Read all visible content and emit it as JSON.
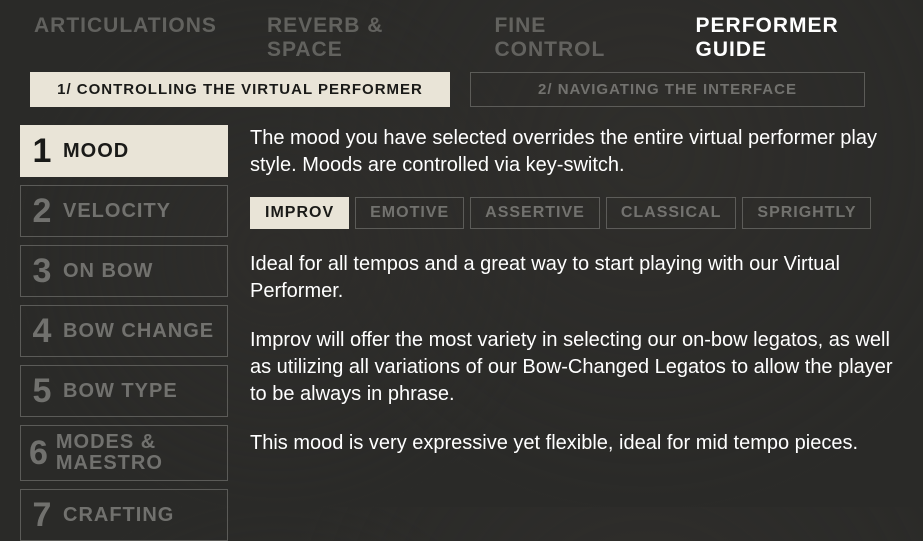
{
  "top_tabs": [
    {
      "label": "ARTICULATIONS",
      "active": false
    },
    {
      "label": "REVERB & SPACE",
      "active": false
    },
    {
      "label": "FINE CONTROL",
      "active": false
    },
    {
      "label": "PERFORMER GUIDE",
      "active": true
    }
  ],
  "sub_tabs": [
    {
      "label": "1/ CONTROLLING THE VIRTUAL PERFORMER",
      "active": true
    },
    {
      "label": "2/ NAVIGATING THE INTERFACE",
      "active": false
    }
  ],
  "side_items": [
    {
      "num": "1",
      "label": "MOOD",
      "active": true
    },
    {
      "num": "2",
      "label": "VELOCITY",
      "active": false
    },
    {
      "num": "3",
      "label": "ON BOW",
      "active": false
    },
    {
      "num": "4",
      "label": "BOW CHANGE",
      "active": false
    },
    {
      "num": "5",
      "label": "BOW TYPE",
      "active": false
    },
    {
      "num": "6",
      "label": "MODES & MAESTRO",
      "active": false
    },
    {
      "num": "7",
      "label": "CRAFTING",
      "active": false
    }
  ],
  "intro": "The mood you have selected overrides the entire virtual performer play style. Moods are controlled via key-switch.",
  "mood_tabs": [
    {
      "label": "IMPROV",
      "active": true
    },
    {
      "label": "EMOTIVE",
      "active": false
    },
    {
      "label": "ASSERTIVE",
      "active": false
    },
    {
      "label": "CLASSICAL",
      "active": false
    },
    {
      "label": "SPRIGHTLY",
      "active": false
    }
  ],
  "paragraphs": [
    "Ideal for all tempos and a great way to start playing with our Virtual Performer.",
    "Improv will offer the most variety in selecting our on-bow legatos, as well as utilizing all variations of our Bow-Changed Legatos to allow the player to be always in phrase.",
    "This mood is very expressive yet flexible, ideal for mid tempo pieces."
  ]
}
